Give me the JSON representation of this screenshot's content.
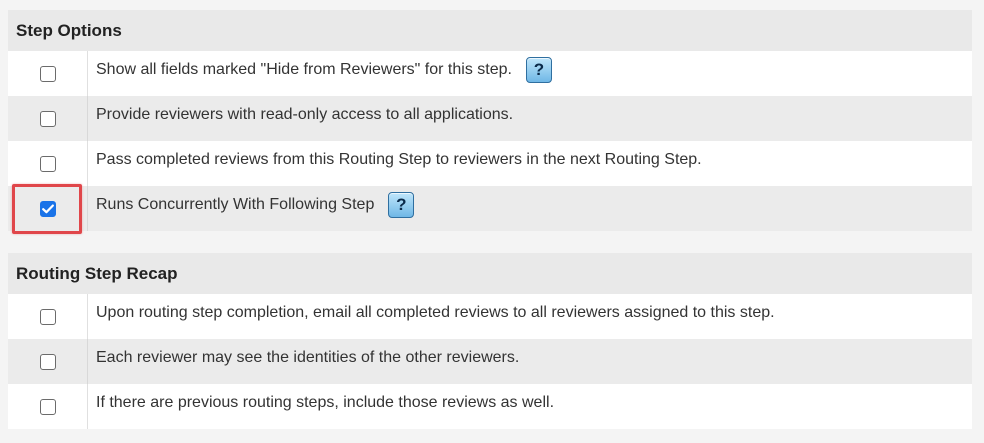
{
  "step_options": {
    "title": "Step Options",
    "items": [
      {
        "label": "Show all fields marked \"Hide from Reviewers\" for this step.",
        "checked": false,
        "help": true,
        "help_glyph": "?"
      },
      {
        "label": "Provide reviewers with read-only access to all applications.",
        "checked": false,
        "help": false
      },
      {
        "label": "Pass completed reviews from this Routing Step to reviewers in the next Routing Step.",
        "checked": false,
        "help": false
      },
      {
        "label": "Runs Concurrently With Following Step",
        "checked": true,
        "help": true,
        "help_glyph": "?",
        "highlighted": true
      }
    ]
  },
  "routing_step_recap": {
    "title": "Routing Step Recap",
    "items": [
      {
        "label": "Upon routing step completion, email all completed reviews to all reviewers assigned to this step.",
        "checked": false
      },
      {
        "label": "Each reviewer may see the identities of the other reviewers.",
        "checked": false
      },
      {
        "label": "If there are previous routing steps, include those reviews as well.",
        "checked": false
      }
    ]
  },
  "colors": {
    "checkbox_checked": "#1a73e8",
    "highlight": "#e0464a",
    "help_button": "#6fb7e6"
  },
  "icons": {
    "help": "question-mark-icon",
    "check": "check-icon"
  }
}
